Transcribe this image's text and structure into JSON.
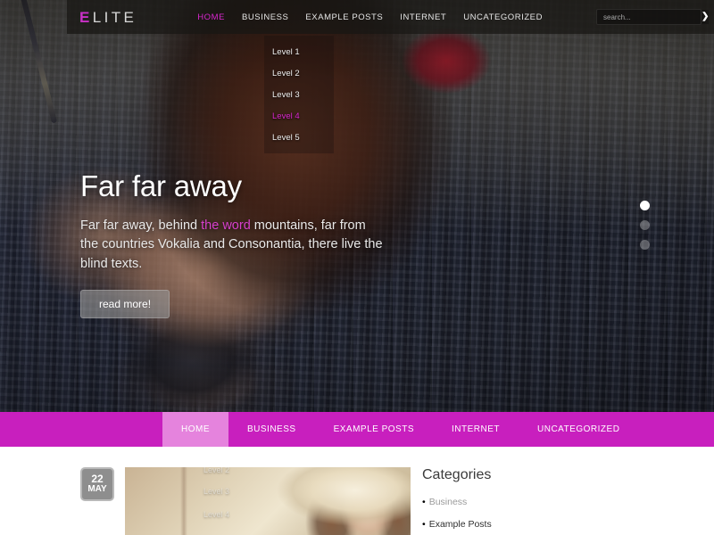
{
  "header": {
    "logo": {
      "accent": "E",
      "rest": "LITE"
    },
    "nav": [
      {
        "label": "HOME",
        "active": true
      },
      {
        "label": "BUSINESS",
        "active": false
      },
      {
        "label": "EXAMPLE POSTS",
        "active": false
      },
      {
        "label": "INTERNET",
        "active": false
      },
      {
        "label": "UNCATEGORIZED",
        "active": false
      }
    ],
    "search": {
      "placeholder": "search...",
      "value": "",
      "button_icon": "chevron-right-icon",
      "button_glyph": "❯"
    }
  },
  "dropdown": {
    "items": [
      {
        "label": "Level 1",
        "active": false
      },
      {
        "label": "Level 2",
        "active": false
      },
      {
        "label": "Level 3",
        "active": false
      },
      {
        "label": "Level 4",
        "active": true
      },
      {
        "label": "Level 5",
        "active": false
      }
    ]
  },
  "hero": {
    "title": "Far far away",
    "desc_part1": "Far far away, behind ",
    "desc_highlight": "the word",
    "desc_part2": " mountains, far from the countries Vokalia and Consonantia, there live the blind texts.",
    "button": "read more!",
    "slider_dots": [
      {
        "active": true
      },
      {
        "active": false
      },
      {
        "active": false
      }
    ]
  },
  "magenta_nav": {
    "items": [
      {
        "label": "HOME",
        "active": true
      },
      {
        "label": "BUSINESS",
        "active": false
      },
      {
        "label": "EXAMPLE POSTS",
        "active": false
      },
      {
        "label": "INTERNET",
        "active": false
      },
      {
        "label": "UNCATEGORIZED",
        "active": false
      }
    ]
  },
  "content": {
    "post": {
      "date_day": "22",
      "date_month": "MAY",
      "thumb_overlay": [
        "Level 2",
        "Level 3",
        "Level 4"
      ]
    },
    "sidebar": {
      "title": "Categories",
      "bullet": "•",
      "categories": [
        {
          "label": "Business",
          "muted": true
        },
        {
          "label": "Example Posts",
          "muted": false
        }
      ]
    }
  },
  "colors": {
    "accent_magenta": "#c81fbe",
    "accent_magenta_light": "#e583dd",
    "logo_accent": "#c930c6",
    "nav_active": "#d927cf"
  }
}
